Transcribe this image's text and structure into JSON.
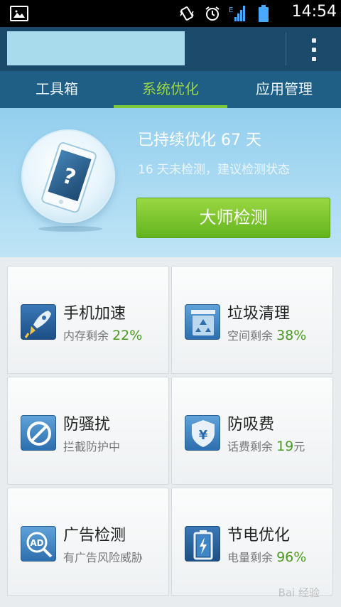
{
  "status_bar": {
    "time": "14:54",
    "signal_label": "E",
    "icons": [
      "picture-icon",
      "vibrate-icon",
      "alarm-icon",
      "signal-icon",
      "battery-icon"
    ]
  },
  "title_bar": {
    "menu_icon": "overflow-menu-icon"
  },
  "tabs": [
    {
      "label": "工具箱",
      "active": false
    },
    {
      "label": "系统优化",
      "active": true
    },
    {
      "label": "应用管理",
      "active": false
    }
  ],
  "hero": {
    "title": "已持续优化 67 天",
    "subtitle": "16 天未检测，建议检测状态",
    "button_label": "大师检测",
    "phone_glyph": "?"
  },
  "tiles": [
    {
      "title": "手机加速",
      "sub_text": "内存剩余 ",
      "value": "22%",
      "unit": "",
      "icon": "rocket-icon"
    },
    {
      "title": "垃圾清理",
      "sub_text": "空间剩余 ",
      "value": "38%",
      "unit": "",
      "icon": "recycle-bin-icon"
    },
    {
      "title": "防骚扰",
      "sub_text": "拦截防护中",
      "value": "",
      "unit": "",
      "icon": "block-icon"
    },
    {
      "title": "防吸费",
      "sub_text": "话费剩余 ",
      "value": "19",
      "unit": "元",
      "icon": "yuan-shield-icon"
    },
    {
      "title": "广告检测",
      "sub_text": "有广告风险威胁",
      "value": "",
      "unit": "",
      "icon": "ad-search-icon"
    },
    {
      "title": "节电优化",
      "sub_text": "电量剩余 ",
      "value": "96%",
      "unit": "",
      "icon": "battery-charge-icon"
    }
  ],
  "watermark": "Bai 经验",
  "colors": {
    "accent_green": "#7cc93a",
    "tab_bar": "#1f5f86",
    "title_bar": "#1b4a6a",
    "hero_bg": "#93cfee"
  }
}
